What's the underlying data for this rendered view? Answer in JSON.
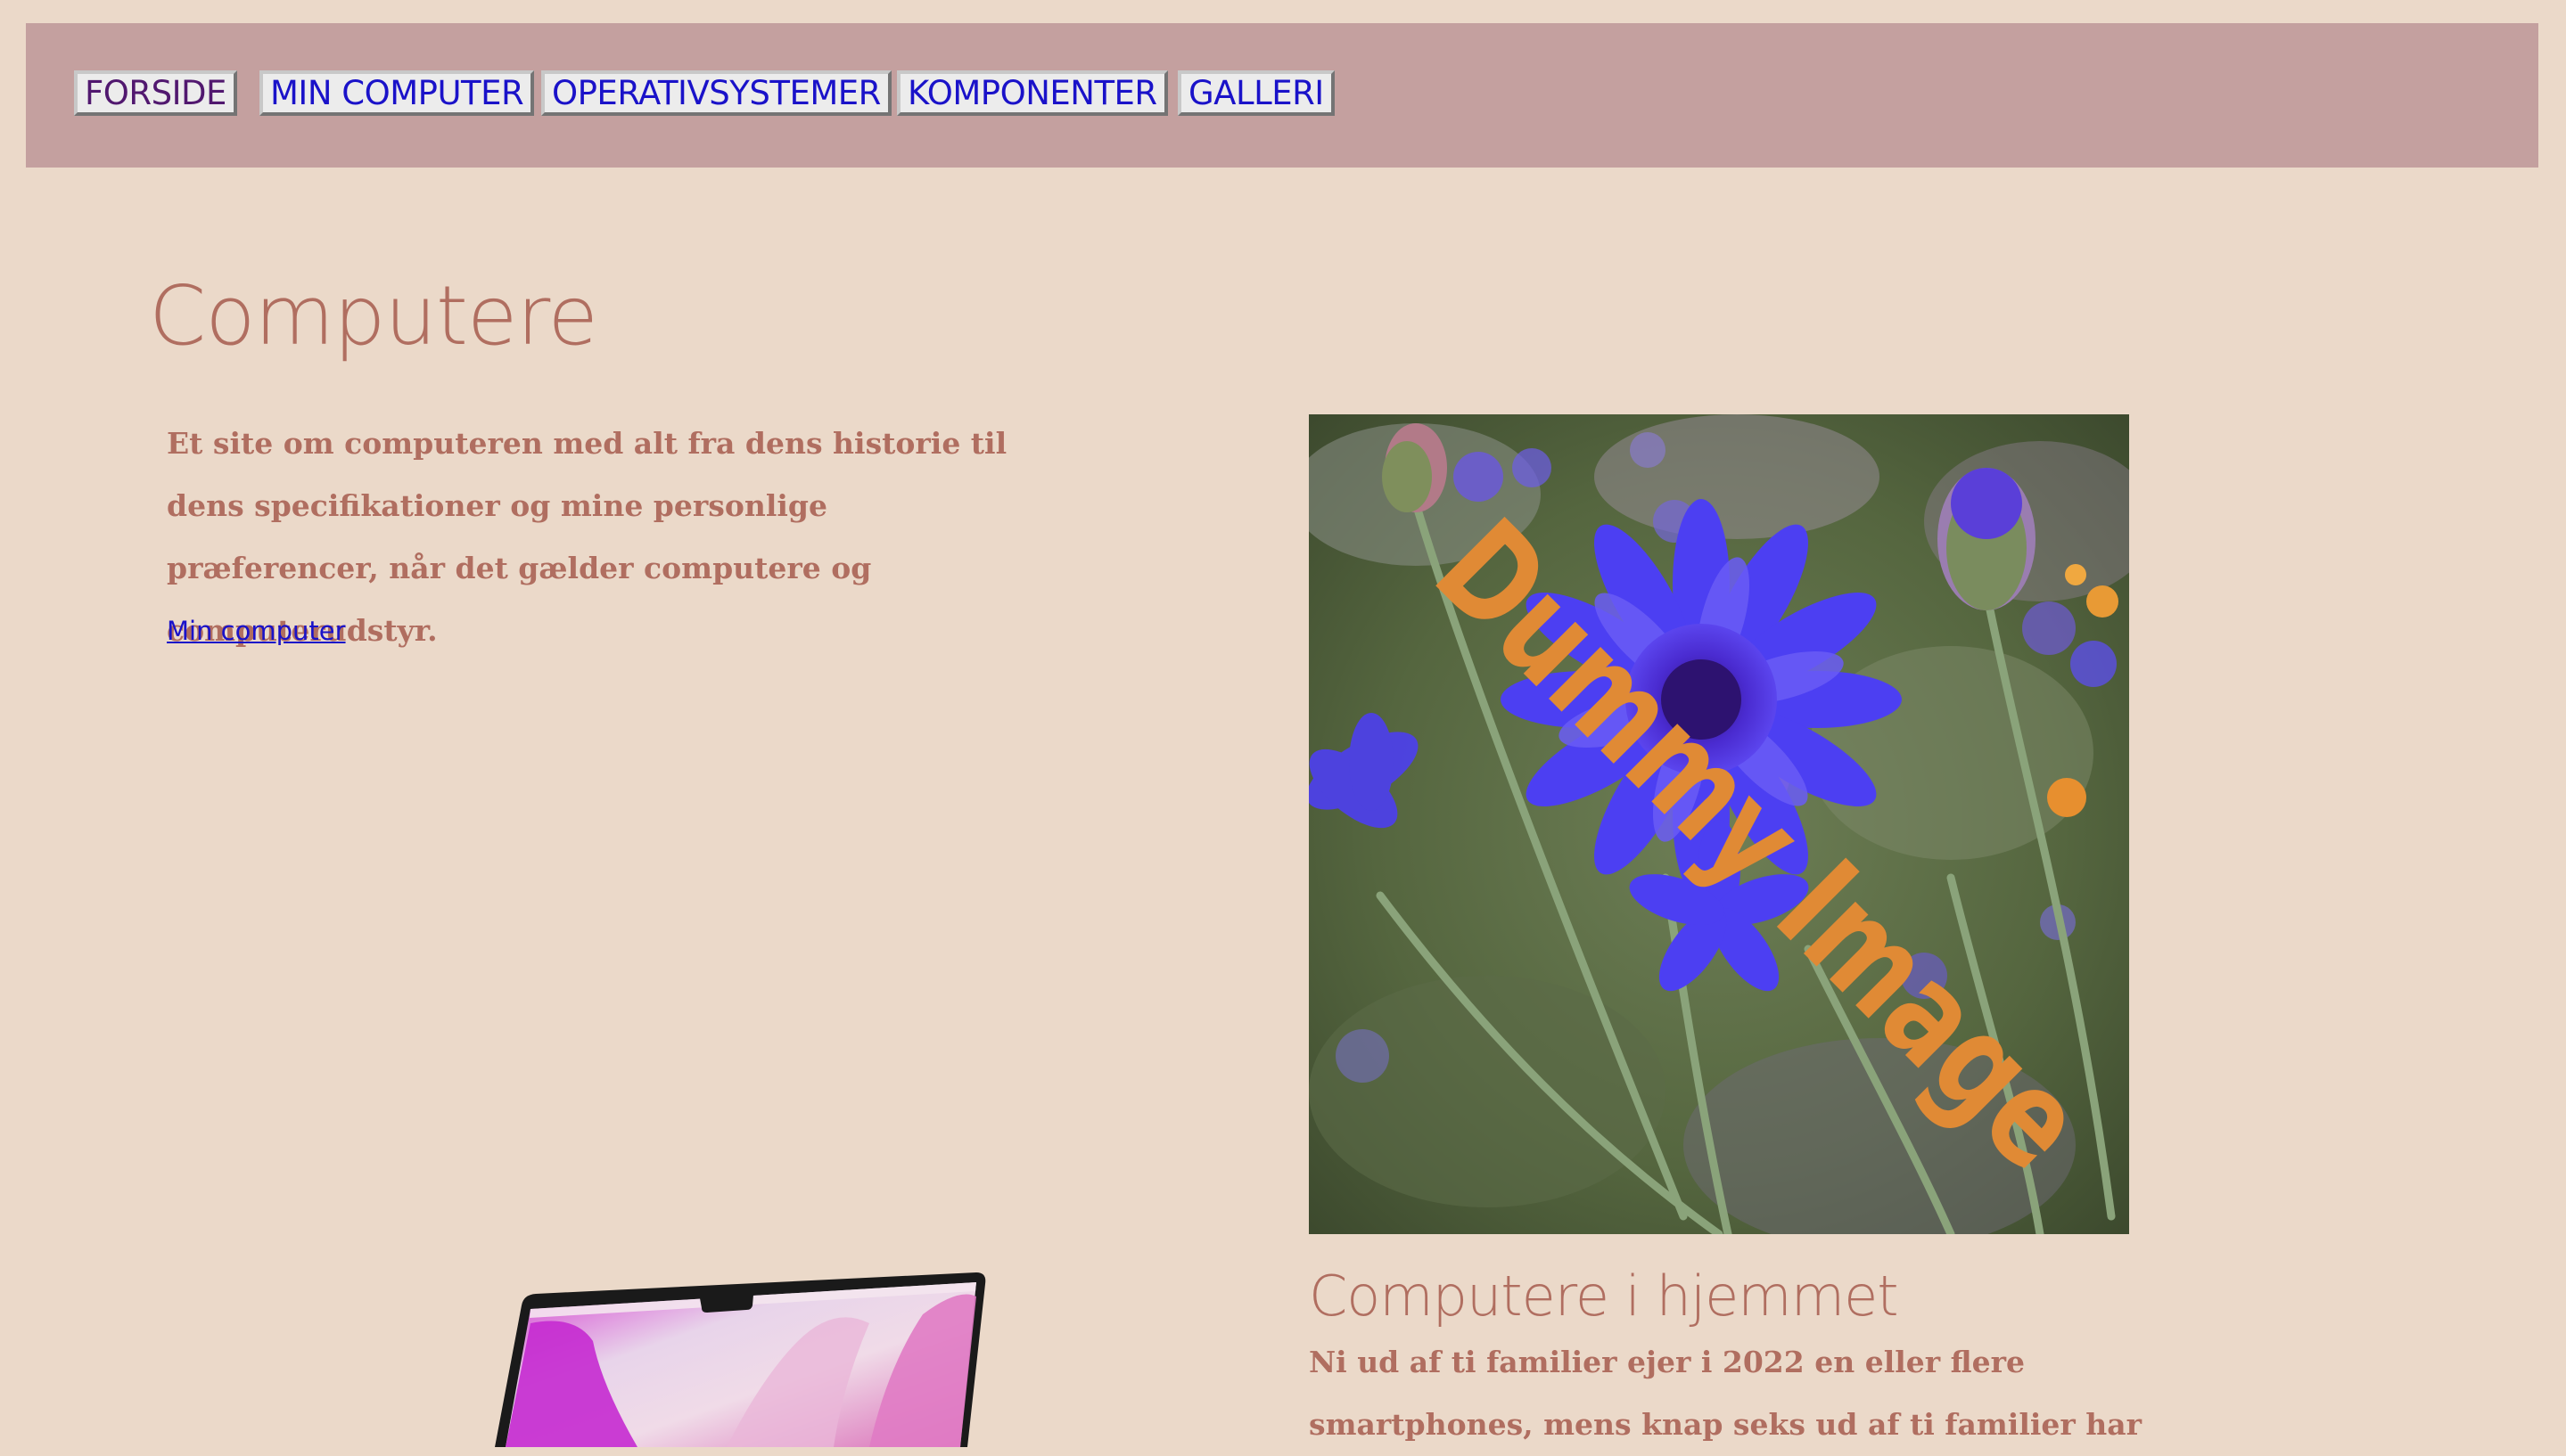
{
  "nav": {
    "items": [
      {
        "label": "FORSIDE"
      },
      {
        "label": "MIN COMPUTER"
      },
      {
        "label": "OPERATIVSYSTEMER"
      },
      {
        "label": "KOMPONENTER"
      },
      {
        "label": "GALLERI"
      }
    ]
  },
  "main": {
    "title": "Computere",
    "intro": "Et site om computeren med alt fra dens historie til dens specifikationer og mine personlige præferencer, når det gælder computere og computerudstyr.",
    "link_label": "Min computer"
  },
  "hero_image": {
    "watermark": "Dummy Image",
    "subject": "cornflower photo"
  },
  "section": {
    "title": "Computere i hjemmet",
    "text": "Ni ud af ti familier ejer i 2022 en eller flere smartphones, mens knap seks ud af ti familier har"
  },
  "colors": {
    "background": "#ebd9c9",
    "navbar": "#c4a09f",
    "text": "#b06e60",
    "link": "#1a12c9",
    "link_visited": "#51186f",
    "watermark": "#e08a35"
  }
}
